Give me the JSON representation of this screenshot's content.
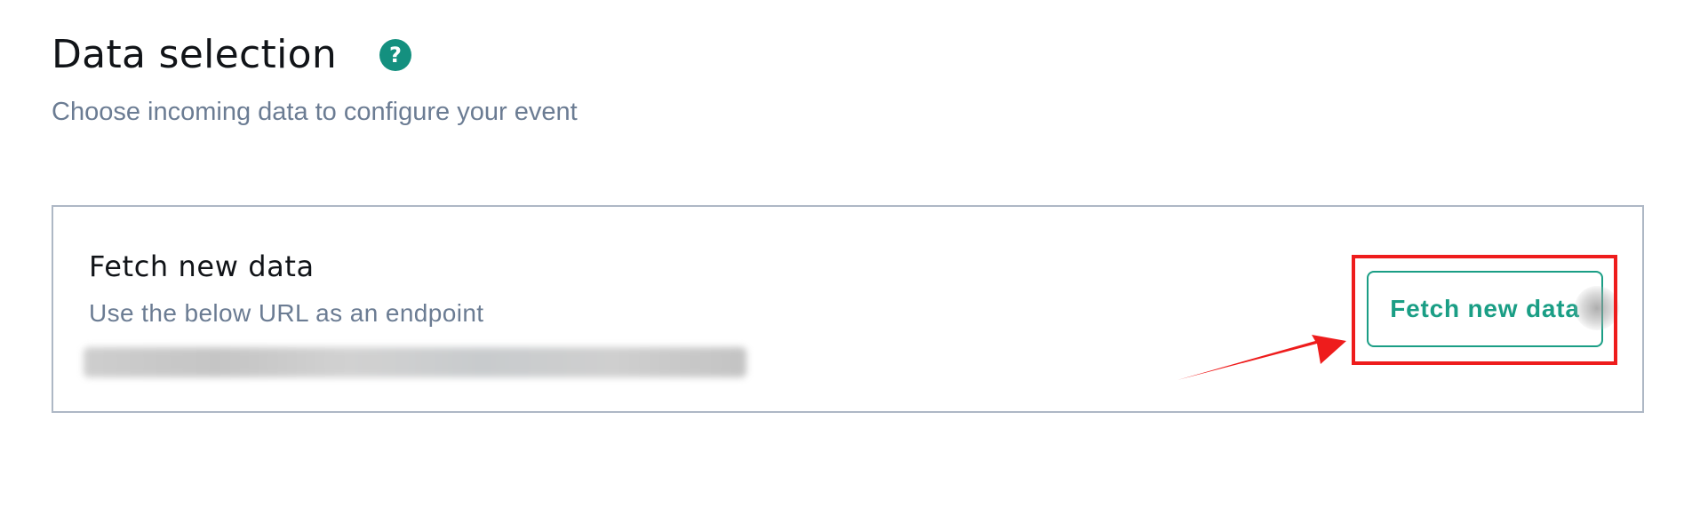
{
  "header": {
    "title": "Data selection",
    "help_icon": "question-circle-icon",
    "subtitle": "Choose incoming data to configure your event"
  },
  "card": {
    "title": "Fetch new data",
    "description": "Use the below URL as an endpoint",
    "button_label": "Fetch new data"
  },
  "colors": {
    "accent": "#1a9e85",
    "help_icon": "#14907f",
    "annotation": "#ee1c1c",
    "muted_text": "#6b7c93",
    "card_border": "#aeb8c5"
  }
}
